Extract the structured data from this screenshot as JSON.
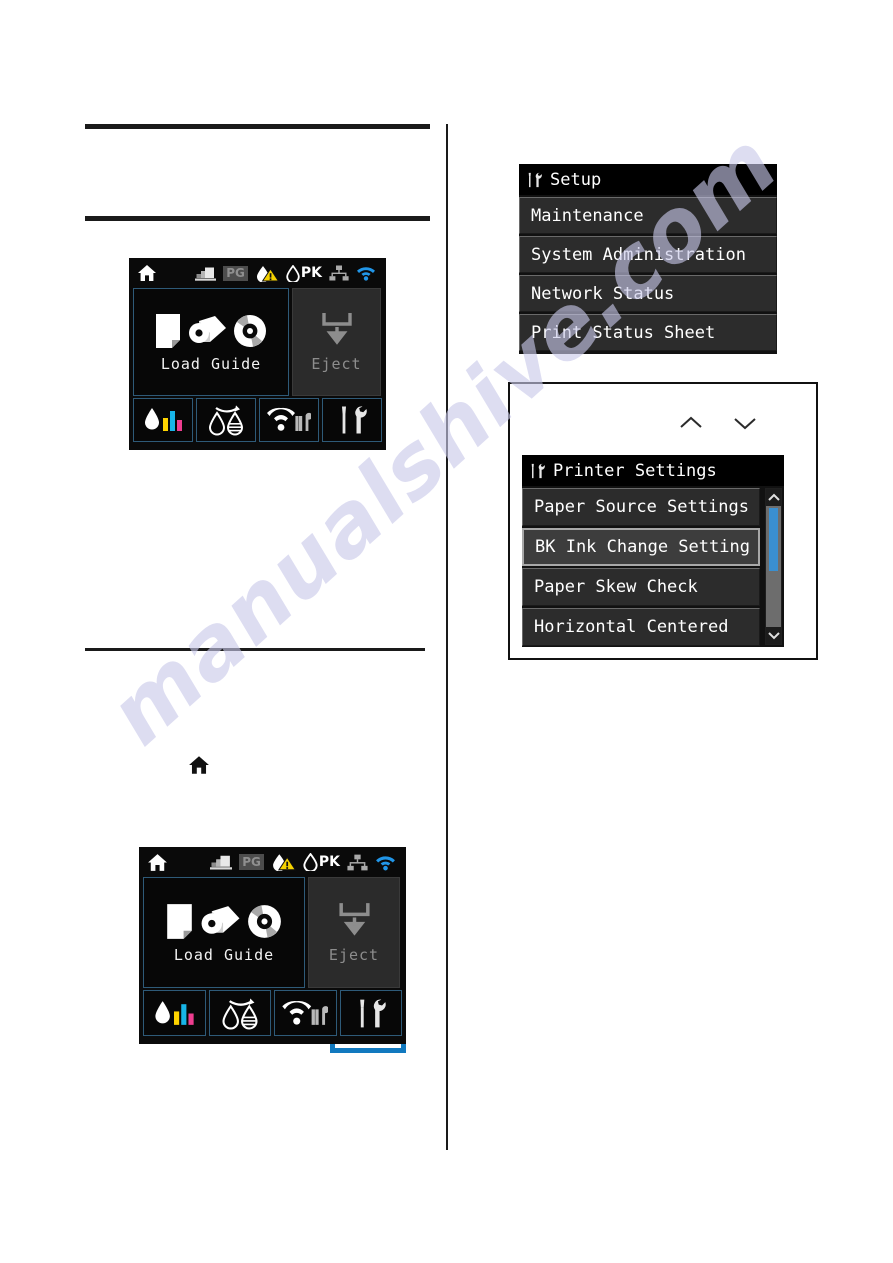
{
  "watermark": {
    "text": "manualshive.com"
  },
  "panel_home_top": {
    "name": "printer-home-screen-top",
    "status_icons": [
      {
        "icon": "paper-stack-icon",
        "label": "Paper"
      },
      {
        "icon": "pg-platen-gap-icon",
        "label": "PG"
      },
      {
        "icon": "ink-warning-icon",
        "label": "Ink Low"
      },
      {
        "icon": "pk-photo-black-icon",
        "label": "PK"
      },
      {
        "icon": "ethernet-icon",
        "label": "Ethernet"
      },
      {
        "icon": "wifi-icon",
        "label": "Wi-Fi"
      }
    ],
    "home_icon": "home-icon",
    "pg_badge": "PG",
    "pk_label": "PK",
    "load_guide_label": "Load Guide",
    "load_guide_icons": [
      "cut-sheet-icon",
      "roll-paper-icon",
      "cd-dvd-icon"
    ],
    "eject_label": "Eject",
    "eject_icon": "eject-down-arrow-icon",
    "tabs": [
      {
        "icon": "ink-level-icon",
        "label": "Ink Levels"
      },
      {
        "icon": "ink-change-icon",
        "label": "BK Ink Change"
      },
      {
        "icon": "wifi-setup-icon",
        "label": "Network Setup"
      },
      {
        "icon": "setup-tools-icon",
        "label": "Setup"
      }
    ],
    "selected_tab_index": -1
  },
  "panel_home_bottom": {
    "name": "printer-home-screen-bottom",
    "home_icon": "home-icon",
    "pg_badge": "PG",
    "pk_label": "PK",
    "load_guide_label": "Load Guide",
    "eject_label": "Eject",
    "tabs": [
      {
        "icon": "ink-level-icon",
        "label": "Ink Levels"
      },
      {
        "icon": "ink-change-icon",
        "label": "BK Ink Change"
      },
      {
        "icon": "wifi-setup-icon",
        "label": "Network Setup"
      },
      {
        "icon": "setup-tools-icon",
        "label": "Setup"
      }
    ],
    "selected_tab_index": 3
  },
  "setup_menu": {
    "title": "Setup",
    "title_icon": "setup-tools-icon",
    "items": [
      {
        "label": "Maintenance",
        "selected": false
      },
      {
        "label": "System Administration",
        "selected": false
      },
      {
        "label": "Network Status",
        "selected": false
      },
      {
        "label": "Print Status Sheet",
        "selected": false
      }
    ]
  },
  "printer_settings_menu": {
    "title": "Printer Settings",
    "title_icon": "setup-tools-icon",
    "items": [
      {
        "label": "Paper Source Settings",
        "selected": false
      },
      {
        "label": "BK Ink Change Setting",
        "selected": true
      },
      {
        "label": "Paper Skew Check",
        "selected": false
      },
      {
        "label": "Horizontal Centered",
        "selected": false
      }
    ],
    "scrollbar": {
      "up_icon": "chevron-up-icon",
      "down_icon": "chevron-down-icon",
      "thumb_position_percent": 8
    },
    "nav_arrows": [
      {
        "icon": "chevron-up-icon"
      },
      {
        "icon": "chevron-down-icon"
      }
    ]
  },
  "home_glyph": {
    "icon": "home-icon"
  },
  "colors": {
    "accent_blue": "#1179bf",
    "scroll_thumb_blue": "#3a8fd0",
    "lcd_background": "#0a0a0a",
    "menu_row": "#2c2c2c",
    "menu_row_selected": "#3d3d3d",
    "watermark": "#c9c9ea"
  }
}
